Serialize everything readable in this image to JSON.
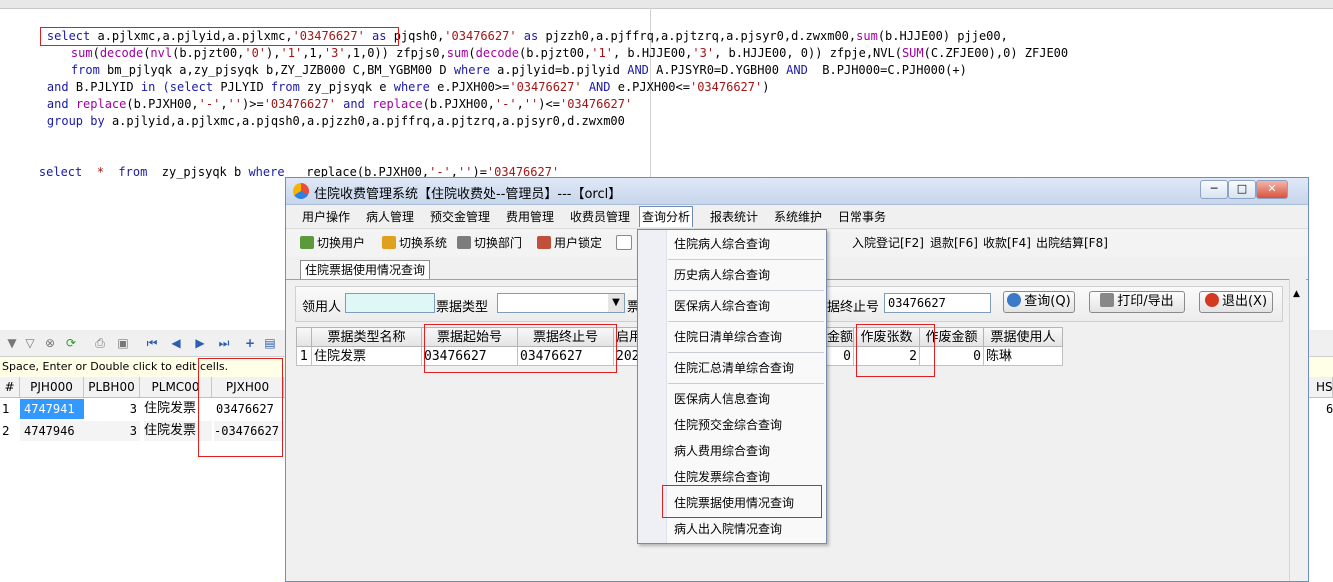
{
  "sql_editor": {
    "line1": {
      "a": "select ",
      "b": "a.pjlxmc,a.pjlyid,a.pjlxmc,",
      "c": "'03476627'",
      "d": " as ",
      "e": "pjqsh0,",
      "f": "'03476627'",
      "g": " as ",
      "h": "pjzzh0,a.pjffrq,a.pjtzrq,a.pjsyr0,d.zwxm00,",
      "i": "sum",
      "j": "(b.HJJE00) pjje00,"
    },
    "line2": {
      "a": "sum",
      "b": "(",
      "c": "decode",
      "d": "(",
      "e": "nvl",
      "f": "(b.pjzt00,",
      "g": "'0'",
      "h": "),",
      "i": "'1'",
      "j": ",1,",
      "k": "'3'",
      "l": ",1,0)) zfpjs0,",
      "m": "sum",
      "n": "(",
      "o": "decode",
      "p": "(b.pjzt00,",
      "q": "'1'",
      "r": ", b.HJJE00,",
      "s": "'3'",
      "t": ", b.HJJE00, 0)) zfpje,NVL(",
      "u": "SUM",
      "v": "(C.ZFJE00),0) ZFJE00"
    },
    "line3": {
      "a": "from ",
      "b": "bm_pjlyqk a,zy_pjsyqk b,ZY_JZB000 C,BM_YGBM00 D ",
      "c": "where ",
      "d": "a.pjlyid=b.pjlyid ",
      "e": "AND ",
      "f": "A.PJSYR0=D.YGBH00 ",
      "g": "AND ",
      "h": " B.PJH000=C.PJH000(+)"
    },
    "line4": {
      "a": "and ",
      "b": "B.PJLYID ",
      "c": "in ",
      "d": "(select ",
      "e": "PJLYID ",
      "f": "from ",
      "g": "zy_pjsyqk e ",
      "h": "where ",
      "i": "e.PJXH00>=",
      "j": "'03476627'",
      "k": " AND ",
      "l": "e.PJXH00<=",
      "m": "'03476627'",
      "n": ")"
    },
    "line5": {
      "a": "and ",
      "b": "replace",
      "c": "(b.PJXH00,",
      "d": "'-'",
      "e": ",",
      "f": "''",
      "g": ")>=",
      "h": "'03476627'",
      "i": " and ",
      "j": "replace",
      "k": "(b.PJXH00,",
      "l": "'-'",
      "m": ",",
      "n": "''",
      "o": ")<=",
      "p": "'03476627'"
    },
    "line6": {
      "a": "group by ",
      "b": "a.pjlyid,a.pjlxmc,a.pjqsh0,a.pjzzh0,a.pjffrq,a.pjtzrq,a.pjsyr0,d.zwxm00"
    },
    "line7": {
      "a": "select ",
      "b": " * ",
      "c": " from ",
      "d": " zy_pjsyqk b ",
      "e": "where ",
      "f": "  replace",
      "g": "(b.PJXH00,",
      "h": "'-'",
      "i": ",",
      "j": "''",
      "k": ")=",
      "l": "'03476627'"
    }
  },
  "results_grid": {
    "hint": "Space, Enter or Double click to edit cells.",
    "columns": [
      "#",
      "PJH000",
      "PLBH00",
      "PLMC00",
      "PJXH00",
      "HS"
    ],
    "rows": [
      {
        "num": "1",
        "pjh000": "4747941",
        "plbh00": "3",
        "plmc00": "住院发票",
        "pjxh00": "03476627",
        "extra": "6"
      },
      {
        "num": "2",
        "pjh000": "4747946",
        "plbh00": "3",
        "plmc00": "住院发票",
        "pjxh00": "-03476627",
        "extra": ""
      }
    ]
  },
  "app_window": {
    "title": "住院收费管理系统【住院收费处--管理员】---【orcl】",
    "menus": [
      "用户操作",
      "病人管理",
      "预交金管理",
      "费用管理",
      "收费员管理",
      "查询分析",
      "报表统计",
      "系统维护",
      "日常事务"
    ],
    "toolbar": {
      "switch_user": "切换用户",
      "switch_system": "切换系统",
      "switch_dept": "切换部门",
      "user_lock": "用户锁定",
      "admit": "入院登记[F2]",
      "refund": "退款[F6]",
      "collect": "收款[F4]",
      "discharge": "出院结算[F8]"
    },
    "tab": "住院票据使用情况查询",
    "filter": {
      "receiver_label": "领用人",
      "receiver_value": "",
      "type_label": "票据类型",
      "type_value": "",
      "ticket_cut": "票",
      "end_no_label": "据终止号",
      "end_no_value": "03476627",
      "query_btn": "查询(Q)",
      "print_btn": "打印/导出",
      "exit_btn": "退出(X)"
    },
    "table": {
      "headers": [
        "",
        "票据类型名称",
        "票据起始号",
        "票据终止号",
        "启用",
        "金额",
        "作废张数",
        "作废金额",
        "票据使用人"
      ],
      "row": {
        "num": "1",
        "type": "住院发票",
        "start": "03476627",
        "end": "03476627",
        "enable": "202",
        "amount": "0",
        "void_count": "2",
        "void_amount": "0",
        "user": "陈琳"
      }
    }
  },
  "dropdown_menu": {
    "items": [
      "住院病人综合查询",
      "历史病人综合查询",
      "医保病人综合查询",
      "住院日清单综合查询",
      "住院汇总清单综合查询",
      "医保病人信息查询",
      "住院预交金综合查询",
      "病人费用综合查询",
      "住院发票综合查询",
      "住院票据使用情况查询",
      "病人出入院情况查询"
    ]
  }
}
